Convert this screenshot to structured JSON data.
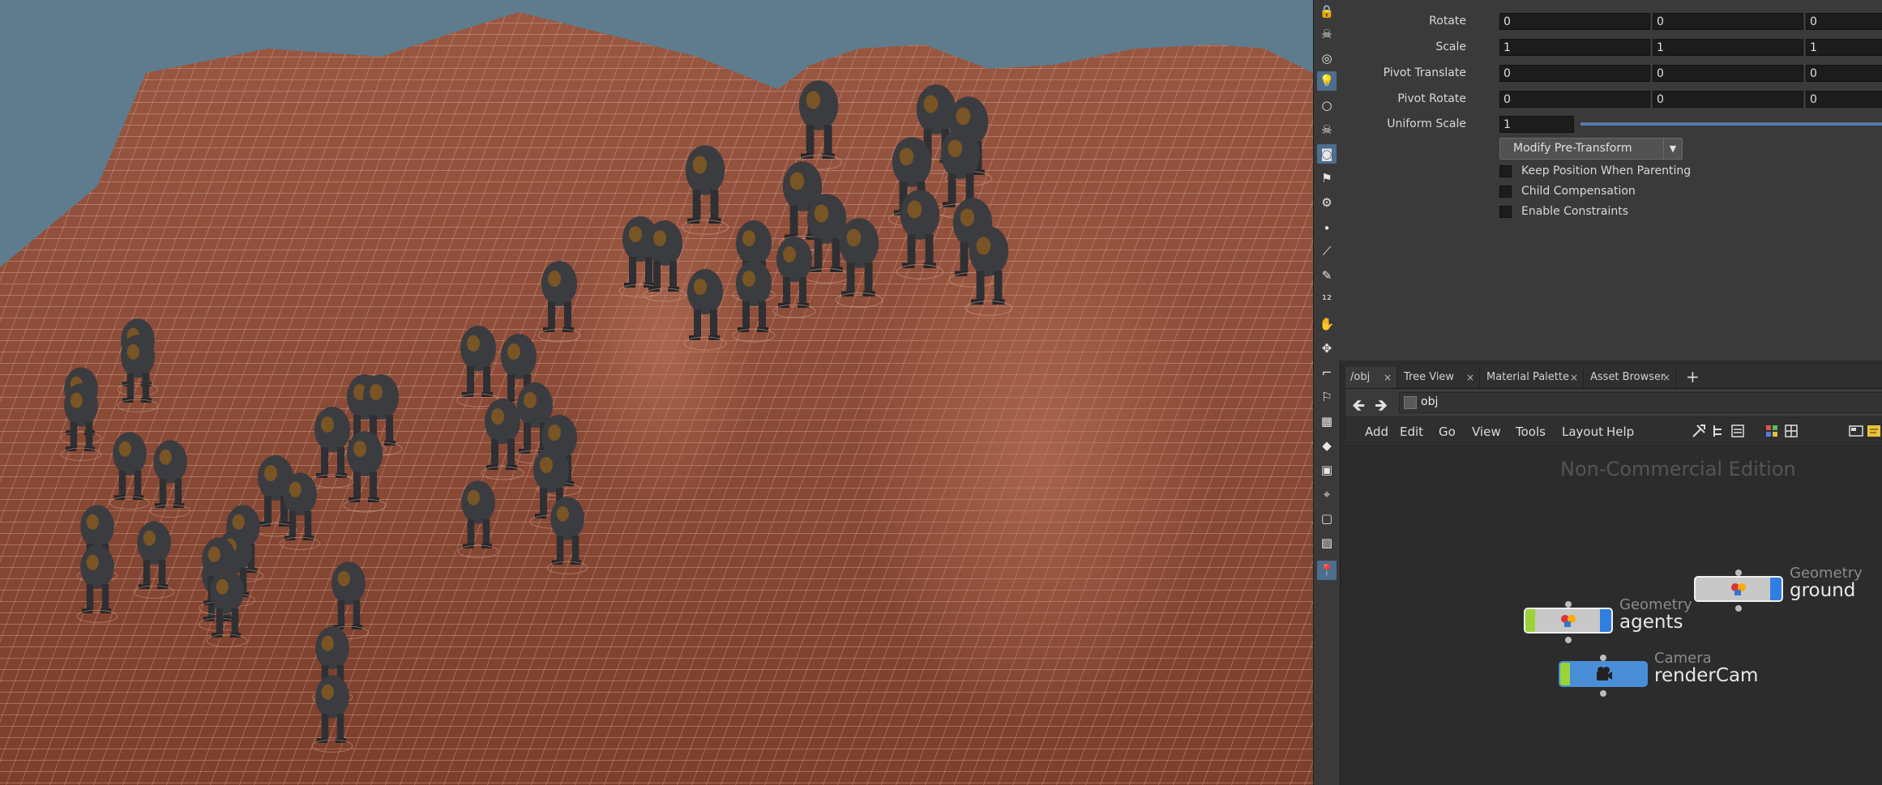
{
  "viewport": {
    "sky_color": "#5e7c8e",
    "terrain_color": "#8a4a35",
    "wire_color": "#d8b4a2",
    "description_objects": "terrain-and-agents"
  },
  "shelf": {
    "icons": [
      "lock-icon",
      "skull-icon",
      "swirl-icon",
      "bulb-icon",
      "bulb-outline-icon",
      "skull-outline-icon",
      "camera-icon",
      "spotlight-icon",
      "camera-rig-icon",
      "dot-icon",
      "brush-icon",
      "pen-icon",
      "number-icon",
      "hand-icon",
      "grab-icon",
      "corner-icon",
      "flag-icon",
      "checker-icon",
      "diamond-icon",
      "grid-icon",
      "point-icon",
      "box-icon",
      "image-icon",
      "pin-icon"
    ]
  },
  "params": {
    "rows": [
      {
        "label": "Rotate",
        "values": [
          "0",
          "0",
          "0"
        ]
      },
      {
        "label": "Scale",
        "values": [
          "1",
          "1",
          "1"
        ]
      },
      {
        "label": "Pivot Translate",
        "values": [
          "0",
          "0",
          "0"
        ]
      },
      {
        "label": "Pivot Rotate",
        "values": [
          "0",
          "0",
          "0"
        ]
      }
    ],
    "uniform_scale": {
      "label": "Uniform Scale",
      "value": "1"
    },
    "modify_button": "Modify Pre-Transform",
    "checkboxes": [
      {
        "label": "Keep Position When Parenting",
        "checked": false
      },
      {
        "label": "Child Compensation",
        "checked": false
      },
      {
        "label": "Enable Constraints",
        "checked": false
      }
    ]
  },
  "tabs": [
    {
      "label": "/obj",
      "selected": true
    },
    {
      "label": "Tree View",
      "selected": false
    },
    {
      "label": "Material Palette",
      "selected": false
    },
    {
      "label": "Asset Browser",
      "selected": false
    }
  ],
  "add_tab": "+",
  "path": {
    "value": "obj"
  },
  "menu": [
    "Add",
    "Edit",
    "Go",
    "View",
    "Tools",
    "Layout",
    "Help"
  ],
  "network": {
    "watermark": "Non-Commercial Edition",
    "nodes": [
      {
        "type": "Geometry",
        "name": "ground",
        "left_color": "#c8c8c8"
      },
      {
        "type": "Geometry",
        "name": "agents",
        "left_color": "#9bd33a"
      },
      {
        "type": "Camera",
        "name": "renderCam",
        "left_color": "#9bd33a"
      }
    ]
  }
}
